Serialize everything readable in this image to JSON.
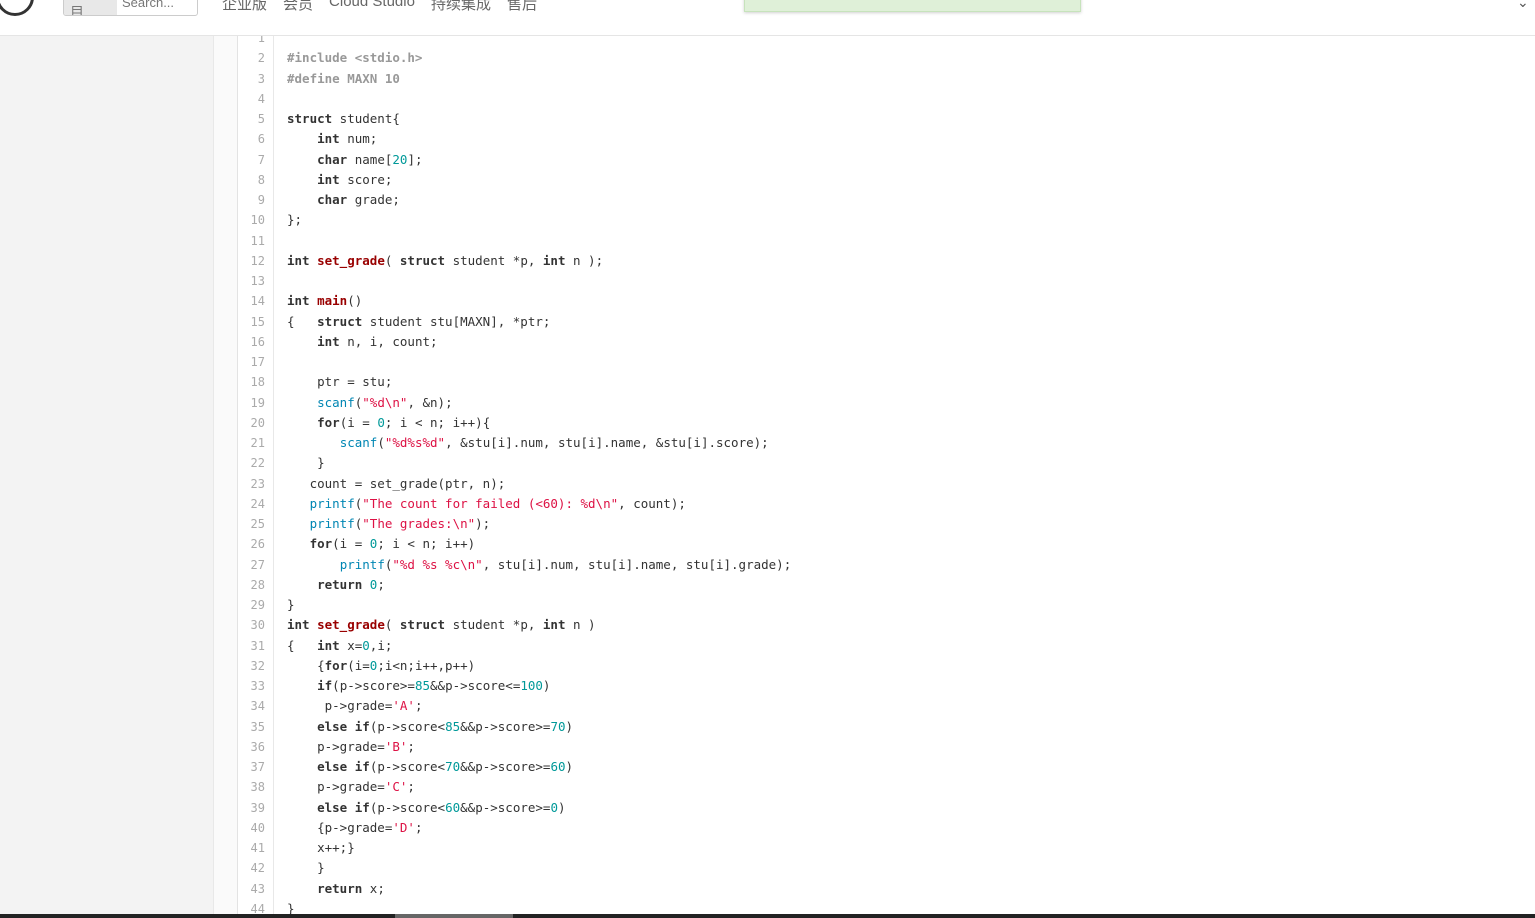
{
  "header": {
    "search_scope": "本项目",
    "search_placeholder": "Search...",
    "nav": [
      "企业版",
      "会员",
      "Cloud Studio",
      "持续集成",
      "售后"
    ]
  },
  "code_lines": [
    "",
    "#include <stdio.h>",
    "#define MAXN 10",
    "",
    "struct student{",
    "    int num;",
    "    char name[20];",
    "    int score;",
    "    char grade;",
    "};",
    "",
    "int set_grade( struct student *p, int n );",
    "",
    "int main()",
    "{   struct student stu[MAXN], *ptr;",
    "    int n, i, count;",
    "",
    "    ptr = stu;",
    "    scanf(\"%d\\n\", &n);",
    "    for(i = 0; i < n; i++){",
    "       scanf(\"%d%s%d\", &stu[i].num, stu[i].name, &stu[i].score);",
    "    }",
    "   count = set_grade(ptr, n);",
    "   printf(\"The count for failed (<60): %d\\n\", count);",
    "   printf(\"The grades:\\n\");",
    "   for(i = 0; i < n; i++)",
    "       printf(\"%d %s %c\\n\", stu[i].num, stu[i].name, stu[i].grade);",
    "    return 0;",
    "}",
    "int set_grade( struct student *p, int n )",
    "{   int x=0,i;",
    "    {for(i=0;i<n;i++,p++)",
    "    if(p->score>=85&&p->score<=100)",
    "     p->grade='A';",
    "    else if(p->score<85&&p->score>=70)",
    "    p->grade='B';",
    "    else if(p->score<70&&p->score>=60)",
    "    p->grade='C';",
    "    else if(p->score<60&&p->score>=0)",
    "    {p->grade='D';",
    "    x++;}",
    "    }",
    "    return x;",
    "}"
  ]
}
